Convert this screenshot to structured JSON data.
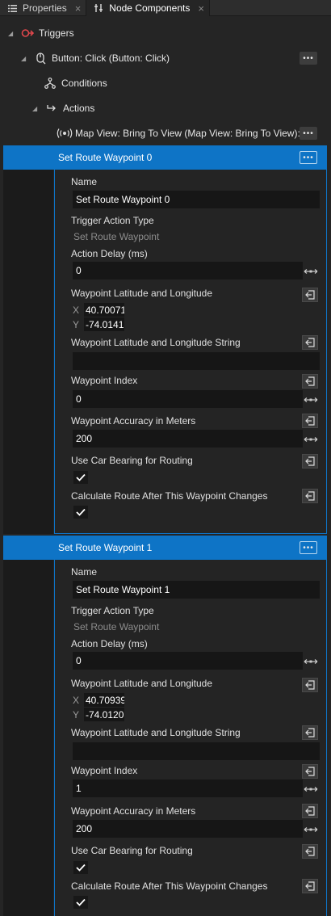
{
  "tabs": [
    {
      "label": "Properties",
      "close": "×"
    },
    {
      "label": "Node Components",
      "close": "×"
    }
  ],
  "tree": {
    "triggers": "Triggers",
    "button_click": "Button: Click (Button: Click)",
    "conditions": "Conditions",
    "actions": "Actions",
    "map_view_action": "Map View: Bring To View (Map View: Bring To View):",
    "more_glyph": "•••"
  },
  "field_labels": {
    "name": "Name",
    "trigger_action_type": "Trigger Action Type",
    "action_delay": "Action Delay (ms)",
    "lat_lng": "Waypoint Latitude and Longitude",
    "lat_lng_string": "Waypoint Latitude and Longitude String",
    "index": "Waypoint Index",
    "accuracy": "Waypoint Accuracy in Meters",
    "car_bearing": "Use Car Bearing for Routing",
    "calc_route": "Calculate Route After This Waypoint Changes",
    "x_axis": "X",
    "y_axis": "Y"
  },
  "waypoints": [
    {
      "title": "Set Route Waypoint 0",
      "name": "Set Route Waypoint 0",
      "trigger_action_type": "Set Route Waypoint",
      "action_delay": "0",
      "lat": "40.70071",
      "lng": "-74.0141",
      "lat_lng_string": "",
      "index": "0",
      "accuracy": "200",
      "use_car_bearing": true,
      "calculate_route": true
    },
    {
      "title": "Set Route Waypoint 1",
      "name": "Set Route Waypoint 1",
      "trigger_action_type": "Set Route Waypoint",
      "action_delay": "0",
      "lat": "40.70939",
      "lng": "-74.0120",
      "lat_lng_string": "",
      "index": "1",
      "accuracy": "200",
      "use_car_bearing": true,
      "calculate_route": true
    }
  ],
  "colors": {
    "accent": "#0e74c6",
    "trigger_icon": "#e0474c"
  }
}
